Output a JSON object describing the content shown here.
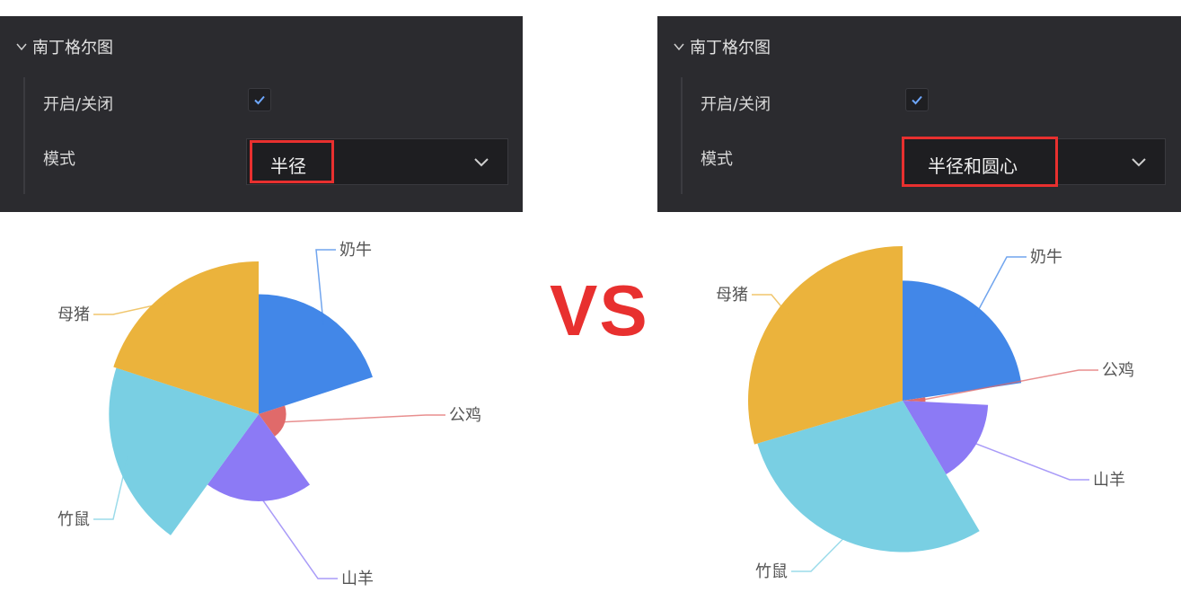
{
  "panels": [
    {
      "header": "南丁格尔图",
      "toggle_label": "开启/关闭",
      "toggle_checked": true,
      "mode_label": "模式",
      "mode_value": "半径"
    },
    {
      "header": "南丁格尔图",
      "toggle_label": "开启/关闭",
      "toggle_checked": true,
      "mode_label": "模式",
      "mode_value": "半径和圆心"
    }
  ],
  "vs_text": "VS",
  "colors": {
    "panel_bg": "#2b2b2f",
    "highlight": "#e8302f",
    "check": "#6ea7ff"
  },
  "chart_data": [
    {
      "type": "pie",
      "rose_type": "radius",
      "categories": [
        "奶牛",
        "公鸡",
        "山羊",
        "竹鼠",
        "母猪"
      ],
      "values": [
        72,
        10,
        50,
        92,
        94
      ],
      "colors": [
        "#4287e8",
        "#e06a6a",
        "#8c7af5",
        "#79cfe3",
        "#ebb33c"
      ]
    },
    {
      "type": "pie",
      "rose_type": "area",
      "categories": [
        "奶牛",
        "公鸡",
        "山羊",
        "竹鼠",
        "母猪"
      ],
      "values": [
        72,
        10,
        50,
        92,
        94
      ],
      "colors": [
        "#4287e8",
        "#e06a6a",
        "#8c7af5",
        "#79cfe3",
        "#ebb33c"
      ]
    }
  ]
}
